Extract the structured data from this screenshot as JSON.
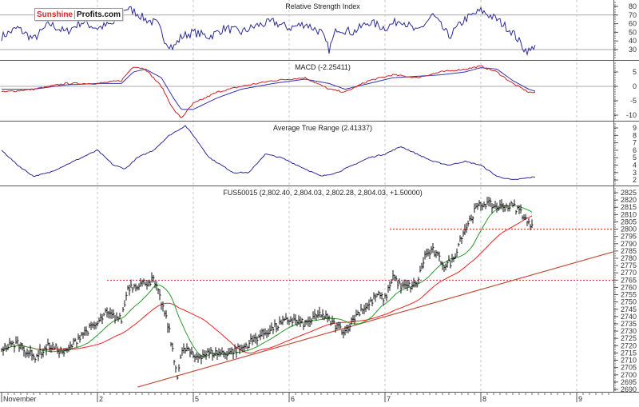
{
  "logo": {
    "part1": "Sunshine",
    "part2": "Profits.com"
  },
  "chart_data": [
    {
      "type": "line",
      "title": "Relative Strength Index",
      "ylim": [
        20,
        85
      ],
      "ticks": [
        "80",
        "70",
        "60",
        "50",
        "40",
        "30"
      ],
      "ref_lines": [
        70,
        30
      ],
      "color": "#2b2b9a",
      "points": [
        [
          0,
          45
        ],
        [
          0.167,
          55
        ],
        [
          0.333,
          42
        ],
        [
          0.5,
          60
        ],
        [
          0.667,
          50
        ],
        [
          0.833,
          62
        ],
        [
          1,
          55
        ],
        [
          1.167,
          60
        ],
        [
          1.292,
          78
        ],
        [
          1.375,
          75
        ],
        [
          1.5,
          65
        ],
        [
          1.625,
          60
        ],
        [
          1.708,
          40
        ],
        [
          1.792,
          32
        ],
        [
          1.875,
          45
        ],
        [
          2,
          50
        ],
        [
          2.167,
          45
        ],
        [
          2.333,
          55
        ],
        [
          2.5,
          50
        ],
        [
          2.667,
          58
        ],
        [
          2.833,
          62
        ],
        [
          3,
          55
        ],
        [
          3.167,
          60
        ],
        [
          3.333,
          50
        ],
        [
          3.417,
          30
        ],
        [
          3.5,
          55
        ],
        [
          3.667,
          50
        ],
        [
          3.833,
          62
        ],
        [
          4,
          55
        ],
        [
          4.167,
          65
        ],
        [
          4.333,
          50
        ],
        [
          4.5,
          70
        ],
        [
          4.667,
          45
        ],
        [
          4.833,
          65
        ],
        [
          5,
          75
        ],
        [
          5.167,
          65
        ],
        [
          5.333,
          50
        ],
        [
          5.458,
          30
        ],
        [
          5.517,
          28
        ],
        [
          5.567,
          37
        ]
      ]
    },
    {
      "type": "line",
      "title": "MACD (-2.25411)",
      "ylim": [
        -13,
        8
      ],
      "ticks": [
        "5",
        "0",
        "-5",
        "-10"
      ],
      "ref_lines": [
        0
      ],
      "series": [
        {
          "name": "MACD",
          "color": "#cc2222"
        },
        {
          "name": "Signal",
          "color": "#3333aa"
        }
      ],
      "points": [
        [
          0,
          -2,
          -1
        ],
        [
          0.333,
          -1,
          -1
        ],
        [
          0.667,
          1,
          0.5
        ],
        [
          1,
          1,
          1
        ],
        [
          1.25,
          2,
          1
        ],
        [
          1.375,
          7,
          5
        ],
        [
          1.5,
          6,
          6
        ],
        [
          1.667,
          0,
          3
        ],
        [
          1.792,
          -8,
          -4
        ],
        [
          1.875,
          -11,
          -8
        ],
        [
          2,
          -6,
          -8
        ],
        [
          2.25,
          -2,
          -4
        ],
        [
          2.5,
          0,
          -1
        ],
        [
          2.833,
          2,
          1
        ],
        [
          3.167,
          3,
          2.5
        ],
        [
          3.417,
          -1,
          1
        ],
        [
          3.583,
          -2,
          -1
        ],
        [
          3.833,
          2,
          1
        ],
        [
          4.083,
          4,
          3
        ],
        [
          4.333,
          3,
          3.5
        ],
        [
          4.583,
          5,
          4
        ],
        [
          4.833,
          6,
          5
        ],
        [
          5,
          7,
          6.5
        ],
        [
          5.167,
          5,
          6
        ],
        [
          5.333,
          1,
          2
        ],
        [
          5.5,
          -2,
          -1
        ],
        [
          5.567,
          -2.25,
          -1.7
        ]
      ]
    },
    {
      "type": "line",
      "title": "Average True Range (2.41337)",
      "ylim": [
        1,
        10
      ],
      "ticks": [
        "9",
        "8",
        "7",
        "6",
        "5",
        "4",
        "3",
        "2"
      ],
      "color": "#2b2b9a",
      "points": [
        [
          0,
          6
        ],
        [
          0.167,
          4
        ],
        [
          0.333,
          2.5
        ],
        [
          0.5,
          3
        ],
        [
          0.667,
          4
        ],
        [
          0.833,
          5
        ],
        [
          1,
          6
        ],
        [
          1.167,
          4
        ],
        [
          1.292,
          3.5
        ],
        [
          1.417,
          5
        ],
        [
          1.583,
          6
        ],
        [
          1.75,
          8
        ],
        [
          1.917,
          9.3
        ],
        [
          2,
          8
        ],
        [
          2.167,
          5
        ],
        [
          2.417,
          3
        ],
        [
          2.583,
          3
        ],
        [
          2.75,
          5.5
        ],
        [
          2.917,
          5
        ],
        [
          3.083,
          4
        ],
        [
          3.25,
          3
        ],
        [
          3.333,
          2.5
        ],
        [
          3.5,
          3
        ],
        [
          3.667,
          4
        ],
        [
          3.833,
          5
        ],
        [
          4,
          5.5
        ],
        [
          4.167,
          6.5
        ],
        [
          4.333,
          5.5
        ],
        [
          4.5,
          4.5
        ],
        [
          4.667,
          4
        ],
        [
          4.833,
          4.5
        ],
        [
          5,
          4
        ],
        [
          5.167,
          2.5
        ],
        [
          5.333,
          2
        ],
        [
          5.5,
          2.3
        ],
        [
          5.567,
          2.41
        ]
      ]
    },
    {
      "type": "line",
      "title": "FUS50015 (2,802.40, 2,804.03, 2,802.28, 2,804.03, +1.50000)",
      "ylim": [
        2688,
        2829
      ],
      "ticks": [
        "2825",
        "2820",
        "2815",
        "2810",
        "2805",
        "2800",
        "2795",
        "2790",
        "2785",
        "2780",
        "2775",
        "2770",
        "2765",
        "2760",
        "2755",
        "2750",
        "2745",
        "2740",
        "2735",
        "2730",
        "2725",
        "2720",
        "2715",
        "2710",
        "2705",
        "2700",
        "2695",
        "2690"
      ],
      "colors": {
        "bars": "#111111",
        "ma_short": "#2a9a2a",
        "ma_long": "#ee2222",
        "trend": "#c0503a",
        "levels": "#d03020"
      },
      "levels": [
        {
          "value": 2800,
          "from": 4.05
        },
        {
          "value": 2765,
          "from": 1.1
        }
      ],
      "trendline": [
        [
          1.42,
          2691.6
        ],
        [
          6.38,
          2784.4
        ]
      ],
      "points": [
        [
          0,
          2718
        ],
        [
          0.167,
          2722
        ],
        [
          0.333,
          2712
        ],
        [
          0.5,
          2720
        ],
        [
          0.667,
          2715
        ],
        [
          0.833,
          2728
        ],
        [
          1,
          2735
        ],
        [
          1.083,
          2742
        ],
        [
          1.25,
          2738
        ],
        [
          1.317,
          2760
        ],
        [
          1.417,
          2762
        ],
        [
          1.583,
          2765
        ],
        [
          1.667,
          2750
        ],
        [
          1.75,
          2730
        ],
        [
          1.792,
          2712
        ],
        [
          1.833,
          2700
        ],
        [
          1.875,
          2715
        ],
        [
          1.933,
          2718
        ],
        [
          2,
          2712
        ],
        [
          2.167,
          2715
        ],
        [
          2.333,
          2715
        ],
        [
          2.5,
          2718
        ],
        [
          2.667,
          2726
        ],
        [
          2.833,
          2732
        ],
        [
          3,
          2738
        ],
        [
          3.167,
          2735
        ],
        [
          3.333,
          2742
        ],
        [
          3.458,
          2735
        ],
        [
          3.583,
          2730
        ],
        [
          3.667,
          2738
        ],
        [
          3.75,
          2745
        ],
        [
          3.833,
          2748
        ],
        [
          3.917,
          2755
        ],
        [
          4,
          2752
        ],
        [
          4.083,
          2768
        ],
        [
          4.167,
          2760
        ],
        [
          4.333,
          2762
        ],
        [
          4.417,
          2782
        ],
        [
          4.5,
          2785
        ],
        [
          4.625,
          2775
        ],
        [
          4.708,
          2778
        ],
        [
          4.792,
          2795
        ],
        [
          4.875,
          2805
        ],
        [
          4.958,
          2815
        ],
        [
          5.042,
          2818
        ],
        [
          5.167,
          2815
        ],
        [
          5.333,
          2816
        ],
        [
          5.417,
          2812
        ],
        [
          5.5,
          2803
        ],
        [
          5.542,
          2804
        ]
      ]
    }
  ],
  "xaxis": {
    "labels": [
      {
        "t": 0,
        "text": "November"
      },
      {
        "t": 1,
        "text": "2"
      },
      {
        "t": 2,
        "text": "5"
      },
      {
        "t": 3,
        "text": "6"
      },
      {
        "t": 4,
        "text": "7"
      },
      {
        "t": 5,
        "text": "8"
      },
      {
        "t": 6,
        "text": "9"
      }
    ]
  }
}
